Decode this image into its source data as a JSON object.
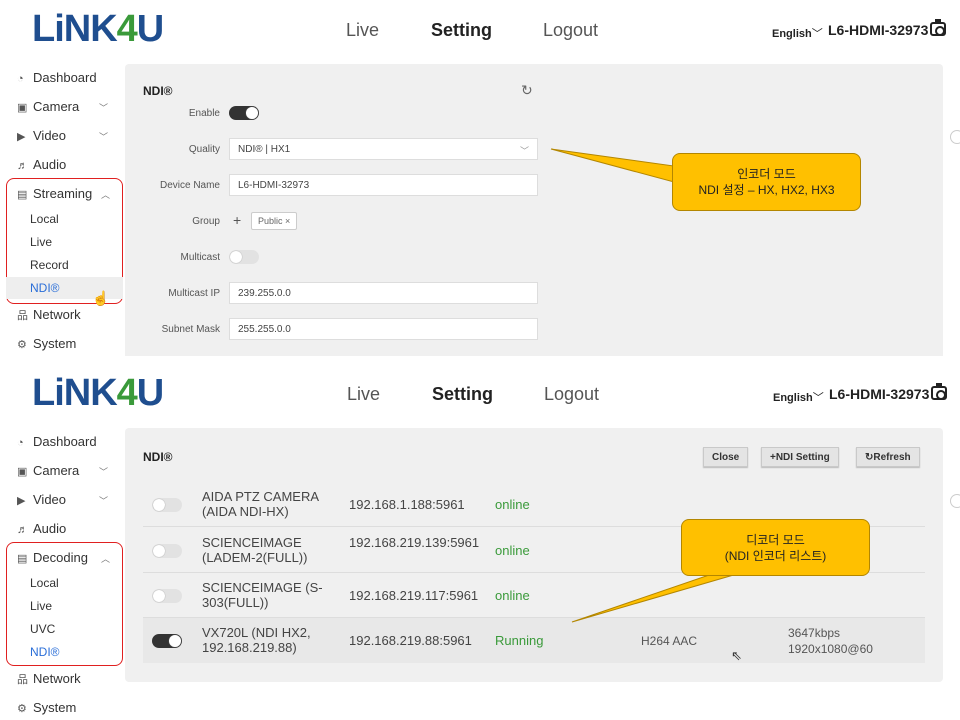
{
  "header": {
    "logo_part1": "LiNK",
    "logo_part2": "4",
    "logo_part3": "U",
    "nav": [
      "Live",
      "Setting",
      "Logout"
    ],
    "active_nav": "Setting",
    "language": "English",
    "device": "L6-HDMI-32973",
    "camera_icon": "camera-icon"
  },
  "encoder_panel": {
    "sidebar": {
      "items": [
        {
          "label": "Dashboard",
          "icon": "dashboard-icon"
        },
        {
          "label": "Camera",
          "icon": "camera-icon"
        },
        {
          "label": "Video",
          "icon": "video-icon"
        },
        {
          "label": "Audio",
          "icon": "audio-icon"
        },
        {
          "label": "Streaming",
          "icon": "streaming-icon"
        },
        {
          "label": "Network",
          "icon": "network-icon"
        },
        {
          "label": "System",
          "icon": "system-icon"
        }
      ],
      "sub_items": [
        "Local",
        "Live",
        "Record",
        "NDI®"
      ],
      "selected": "NDI®"
    },
    "title": "NDI®",
    "fields": {
      "enable_label": "Enable",
      "quality_label": "Quality",
      "quality_value": "NDI® | HX1",
      "device_name_label": "Device Name",
      "device_name_value": "L6-HDMI-32973",
      "group_label": "Group",
      "group_chip": "Public",
      "multicast_label": "Multicast",
      "multicast_ip_label": "Multicast IP",
      "multicast_ip_value": "239.255.0.0",
      "subnet_mask_label": "Subnet Mask",
      "subnet_mask_value": "255.255.0.0"
    },
    "enable_on": true,
    "multicast_on": false,
    "callout_line1": "인코더 모드",
    "callout_line2": "NDI 설정 – HX, HX2, HX3"
  },
  "decoder_panel": {
    "sidebar": {
      "items": [
        {
          "label": "Dashboard",
          "icon": "dashboard-icon"
        },
        {
          "label": "Camera",
          "icon": "camera-icon"
        },
        {
          "label": "Video",
          "icon": "video-icon"
        },
        {
          "label": "Audio",
          "icon": "audio-icon"
        },
        {
          "label": "Decoding",
          "icon": "decoding-icon"
        },
        {
          "label": "Network",
          "icon": "network-icon"
        },
        {
          "label": "System",
          "icon": "system-icon"
        }
      ],
      "sub_items": [
        "Local",
        "Live",
        "UVC",
        "NDI®"
      ],
      "selected": "NDI®"
    },
    "title": "NDI®",
    "buttons": {
      "close": "Close",
      "ndi_setting": "+NDI Setting",
      "refresh": "Refresh"
    },
    "rows": [
      {
        "name": "AIDA PTZ CAMERA (AIDA NDI-HX)",
        "ip": "192.168.1.188:5961",
        "status": "online",
        "codec": "",
        "bitrate": "",
        "resolution": "",
        "on": false
      },
      {
        "name": "SCIENCEIMAGE (LADEM-2(FULL))",
        "ip": "192.168.219.139:5961",
        "status": "online",
        "codec": "",
        "bitrate": "",
        "resolution": "",
        "on": false
      },
      {
        "name": "SCIENCEIMAGE (S-303(FULL))",
        "ip": "192.168.219.117:5961",
        "status": "online",
        "codec": "",
        "bitrate": "",
        "resolution": "",
        "on": false
      },
      {
        "name": "VX720L (NDI HX2, 192.168.219.88)",
        "ip": "192.168.219.88:5961",
        "status": "Running",
        "codec": "H264 AAC",
        "bitrate": "3647kbps",
        "resolution": "1920x1080@60",
        "on": true
      }
    ],
    "callout_line1": "디코더 모드",
    "callout_line2": "(NDI 인코더 리스트)"
  },
  "colors": {
    "accent_blue": "#2a6ed8",
    "status_green": "#3a9a3a",
    "callout": "#ffc000",
    "highlight_red": "#e02020"
  }
}
